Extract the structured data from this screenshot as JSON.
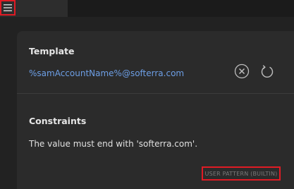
{
  "header": {
    "menu_icon": "hamburger-menu-icon"
  },
  "template": {
    "title": "Template",
    "value": "%samAccountName%@softerra.com",
    "clear_icon": "clear-circle-x-icon",
    "reset_icon": "reset-rotate-icon"
  },
  "constraints": {
    "title": "Constraints",
    "text": "The value must end with 'softerra.com'."
  },
  "badge": {
    "label": "USER PATTERN (BUILTIN)"
  },
  "colors": {
    "accent_link": "#6d9fe6",
    "highlight_red": "#e01b24",
    "panel_bg": "#2b2b2b",
    "page_bg": "#222222"
  }
}
